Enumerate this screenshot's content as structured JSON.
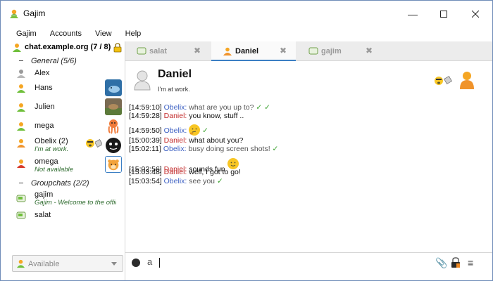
{
  "window": {
    "title": "Gajim"
  },
  "menu": [
    "Gajim",
    "Accounts",
    "View",
    "Help"
  ],
  "roster": {
    "account": "chat.example.org (7 / 8)",
    "groups": [
      {
        "label": "General (5/6)"
      },
      {
        "label": "Groupchats (2/2)"
      }
    ],
    "contacts": [
      {
        "name": "Alex",
        "status": ""
      },
      {
        "name": "Hans",
        "status": ""
      },
      {
        "name": "Julien",
        "status": ""
      },
      {
        "name": "mega",
        "status": ""
      },
      {
        "name": "Obelix (2)",
        "status": "I'm at work."
      },
      {
        "name": "omega",
        "status": "Not available"
      }
    ],
    "groupchats": [
      {
        "name": "gajim",
        "status": "Gajim - Welcome to the official"
      },
      {
        "name": "salat",
        "status": ""
      }
    ],
    "presence": "Available"
  },
  "tabs": [
    {
      "label": "salat",
      "close": "✖"
    },
    {
      "label": "Daniel",
      "close": "✖"
    },
    {
      "label": "gajim",
      "close": "✖"
    }
  ],
  "chat": {
    "name": "Daniel",
    "status": "I'm at work.",
    "messages": [
      {
        "ts": "[14:59:10]",
        "nick": "Obelix:",
        "body": "what are you up to?",
        "from": "self",
        "checks": "✓ ✓"
      },
      {
        "ts": "[14:59:28]",
        "nick": "Daniel:",
        "body": "you know, stuff ..",
        "from": "other",
        "checks": ""
      },
      {
        "ts": "[14:59:50]",
        "nick": "Obelix:",
        "body": "",
        "from": "self",
        "checks": "✓",
        "emoji": "thinking"
      },
      {
        "ts": "[15:00:39]",
        "nick": "Daniel:",
        "body": "what about you?",
        "from": "other",
        "checks": ""
      },
      {
        "ts": "[15:02:11]",
        "nick": "Obelix:",
        "body": "busy doing screen shots!",
        "from": "self",
        "checks": "✓"
      },
      {
        "ts": "[15:02:56]",
        "nick": "Daniel:",
        "body": "sounds fun",
        "from": "other",
        "checks": "",
        "emoji": "smile"
      },
      {
        "ts": "[15:03:48]",
        "nick": "Daniel:",
        "body": "well, I got to go!",
        "from": "other",
        "checks": ""
      },
      {
        "ts": "[15:03:54]",
        "nick": "Obelix:",
        "body": "see you",
        "from": "self",
        "checks": "✓"
      }
    ]
  },
  "input": {
    "format_glyph": "a",
    "attach_glyph": "📎",
    "menu_glyph": "≡"
  },
  "colors": {
    "accent": "#3b7fc4",
    "self_nick": "#3a5ec2",
    "other_nick": "#c22a2a",
    "check": "#37a02b"
  }
}
